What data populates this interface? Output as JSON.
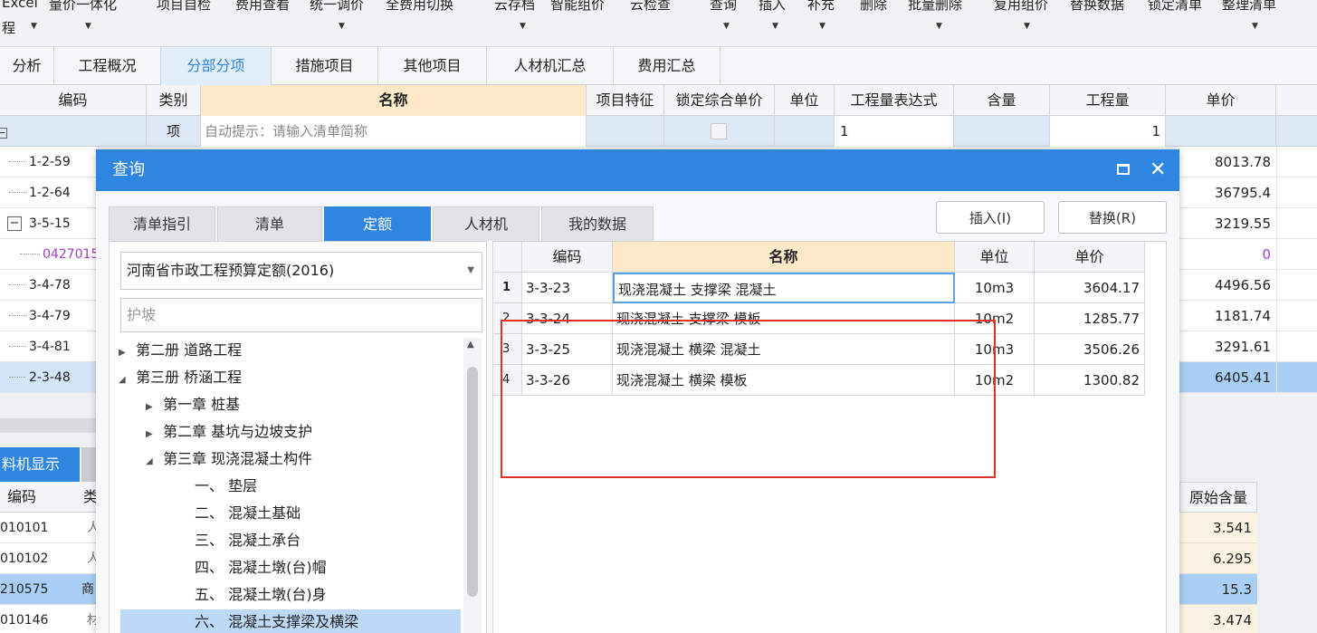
{
  "ribbon": {
    "items": [
      "Excel",
      "量价一体化",
      "项目自检",
      "费用查看",
      "统一调价",
      "全费用切换",
      "云存档",
      "智能组价",
      "云检查",
      "查询",
      "插入",
      "补充",
      "删除",
      "批量删除",
      "复用组价",
      "替换数据",
      "锁定清单",
      "整理清单"
    ],
    "excel_second_line": "程"
  },
  "tabs": [
    "分析",
    "工程概况",
    "分部分项",
    "措施项目",
    "其他项目",
    "人材机汇总",
    "费用汇总"
  ],
  "active_tab": "分部分项",
  "main_table": {
    "headers": [
      "编码",
      "类别",
      "名称",
      "项目特征",
      "锁定综合单价",
      "单位",
      "工程量表达式",
      "含量",
      "工程量",
      "单价"
    ],
    "first_row": {
      "type": "项",
      "name_placeholder": "自动提示：请输入清单简称",
      "expr": "1",
      "qty": "1",
      "expand": "−"
    },
    "rows": [
      {
        "code": "1-2-59",
        "price": "8013.78"
      },
      {
        "code": "1-2-64",
        "price": "36795.4"
      },
      {
        "code": "3-5-15",
        "price": "3219.55",
        "expand": "−"
      },
      {
        "code": "0427015",
        "price": "0"
      },
      {
        "code": "3-4-78",
        "price": "4496.56"
      },
      {
        "code": "3-4-79",
        "price": "1181.74"
      },
      {
        "code": "3-4-81",
        "price": "3291.61"
      },
      {
        "code": "2-3-48",
        "price": "6405.41"
      }
    ]
  },
  "bottom_panel": {
    "tab": "料机显示",
    "headers": [
      "编码",
      "类"
    ],
    "orig_header": "原始含量",
    "rows": [
      {
        "code": "010101",
        "type": "人",
        "orig": "3.541"
      },
      {
        "code": "010102",
        "type": "人",
        "orig": "6.295"
      },
      {
        "code": "210575",
        "type": "商",
        "orig": "15.3"
      },
      {
        "code": "010146",
        "type": "材",
        "orig": "3.474"
      }
    ]
  },
  "dialog": {
    "title": "查询",
    "tabs": [
      "清单指引",
      "清单",
      "定额",
      "人材机",
      "我的数据"
    ],
    "active_tab": "定额",
    "insert_button": "插入(I)",
    "replace_button": "替换(R)",
    "library": "河南省市政工程预算定额(2016)",
    "search_value": "护坡",
    "tree": [
      {
        "label": "第二册 道路工程",
        "expanded": false
      },
      {
        "label": "第三册 桥涵工程",
        "expanded": true
      },
      {
        "label": "第一章 桩基",
        "expanded": false
      },
      {
        "label": "第二章 基坑与边坡支护",
        "expanded": false
      },
      {
        "label": "第三章 现浇混凝土构件",
        "expanded": true
      },
      {
        "label": "一、 垫层"
      },
      {
        "label": "二、 混凝土基础"
      },
      {
        "label": "三、 混凝土承台"
      },
      {
        "label": "四、 混凝土墩(台)帽"
      },
      {
        "label": "五、 混凝土墩(台)身"
      },
      {
        "label": "六、 混凝土支撑梁及横梁",
        "selected": true
      }
    ],
    "grid": {
      "headers": [
        "编码",
        "名称",
        "单位",
        "单价"
      ],
      "rows": [
        {
          "idx": "1",
          "code": "3-3-23",
          "name": "现浇混凝土 支撑梁 混凝土",
          "unit": "10m3",
          "price": "3604.17"
        },
        {
          "idx": "2",
          "code": "3-3-24",
          "name": "现浇混凝土 支撑梁 模板",
          "unit": "10m2",
          "price": "1285.77"
        },
        {
          "idx": "3",
          "code": "3-3-25",
          "name": "现浇混凝土 横梁 混凝土",
          "unit": "10m3",
          "price": "3506.26"
        },
        {
          "idx": "4",
          "code": "3-3-26",
          "name": "现浇混凝土 横梁 模板",
          "unit": "10m2",
          "price": "1300.82"
        }
      ]
    }
  },
  "colors": {
    "accent": "#2f86e0",
    "highlight_box": "#e0302a",
    "name_header": "#fde8c8"
  }
}
